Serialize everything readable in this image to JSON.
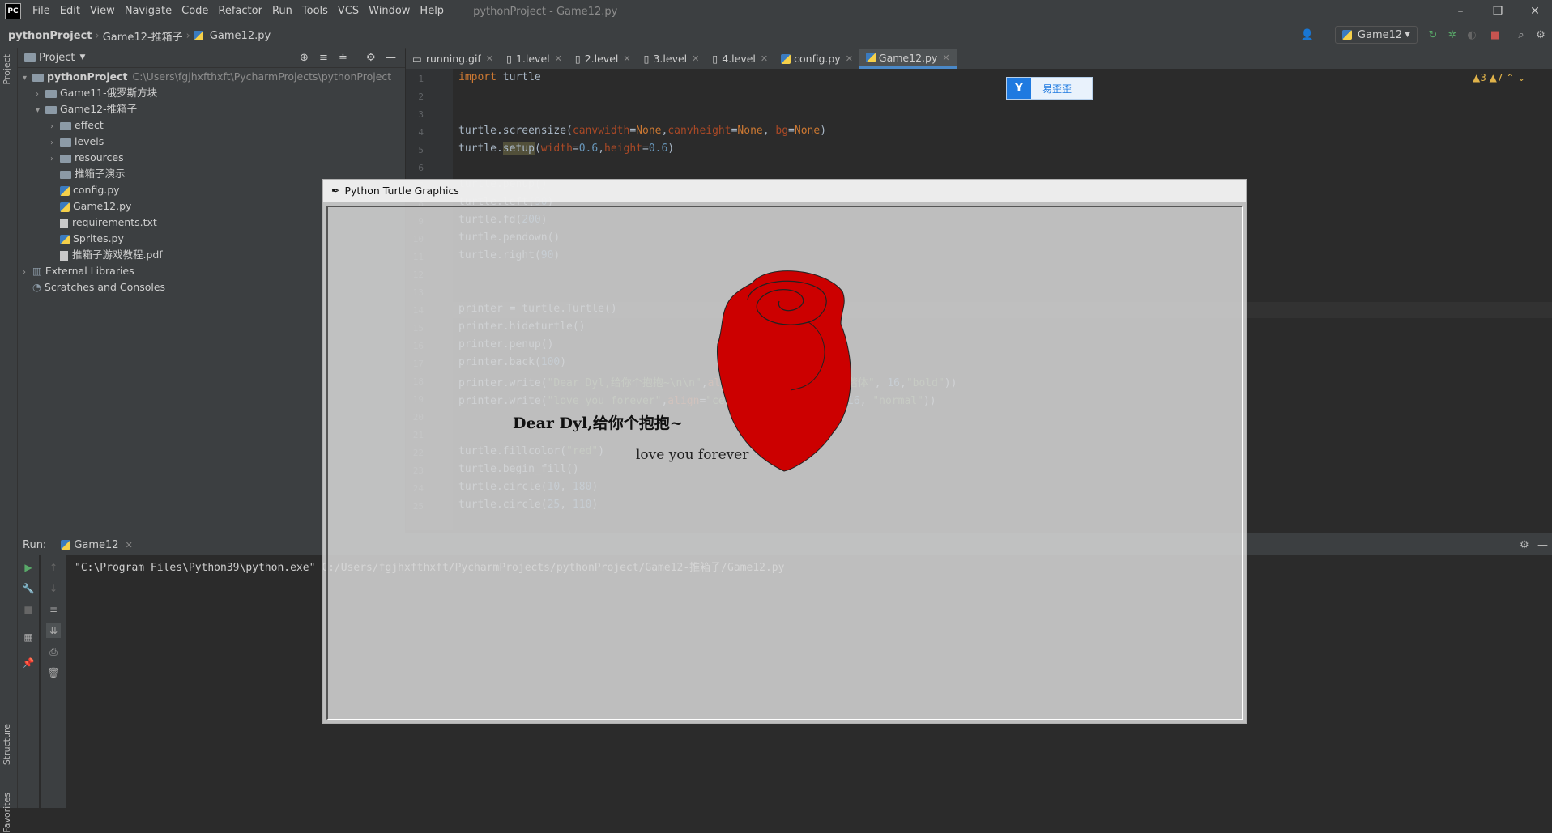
{
  "app": {
    "logo": "PC",
    "menu": [
      "File",
      "Edit",
      "View",
      "Navigate",
      "Code",
      "Refactor",
      "Run",
      "Tools",
      "VCS",
      "Window",
      "Help"
    ],
    "window_title": "pythonProject - Game12.py",
    "win_controls": {
      "minimize": "–",
      "restore": "❐",
      "close": "✕"
    }
  },
  "navbar": {
    "breadcrumbs": [
      "pythonProject",
      "Game12-推箱子",
      "Game12.py"
    ],
    "run_config": "Game12"
  },
  "left_strip": {
    "project_tab": "Project",
    "structure_tab": "Structure",
    "favorites_tab": "Favorites"
  },
  "project": {
    "header": "Project",
    "tree": [
      {
        "label": "pythonProject",
        "path": "C:\\Users\\fgjhxfthxft\\PycharmProjects\\pythonProject"
      },
      {
        "label": "Game11-俄罗斯方块"
      },
      {
        "label": "Game12-推箱子"
      },
      {
        "label": "effect"
      },
      {
        "label": "levels"
      },
      {
        "label": "resources"
      },
      {
        "label": "推箱子演示"
      },
      {
        "label": "config.py"
      },
      {
        "label": "Game12.py"
      },
      {
        "label": "requirements.txt"
      },
      {
        "label": "Sprites.py"
      },
      {
        "label": "推箱子游戏教程.pdf"
      },
      {
        "label": "External Libraries"
      },
      {
        "label": "Scratches and Consoles"
      }
    ]
  },
  "editor": {
    "tabs": [
      "running.gif",
      "1.level",
      "2.level",
      "3.level",
      "4.level",
      "config.py",
      "Game12.py"
    ],
    "active_tab": "Game12.py",
    "line_numbers": [
      "1",
      "2",
      "3",
      "4",
      "5",
      "6",
      "7",
      "8",
      "9",
      "10",
      "11",
      "12",
      "13",
      "14",
      "15",
      "16",
      "17",
      "18",
      "19",
      "20",
      "21",
      "22",
      "23",
      "24",
      "25"
    ],
    "warnings": "▲3  ▲7  ⌃  ⌄"
  },
  "widget": {
    "logo": "Y",
    "label": "易歪歪"
  },
  "run": {
    "label": "Run:",
    "tab": "Game12",
    "command": "\"C:\\Program Files\\Python39\\python.exe\" C:/Users/fgjhxfthxft/PycharmProjects/pythonProject/Game12-推箱子/Game12.py"
  },
  "turtle": {
    "title": "Python Turtle Graphics",
    "message1": "Dear Dyl,给你个抱抱~",
    "message2": "love you forever",
    "rose_color": "#cc0000"
  },
  "colors": {
    "accent": "#4a88c7",
    "rose": "#cc0000"
  }
}
